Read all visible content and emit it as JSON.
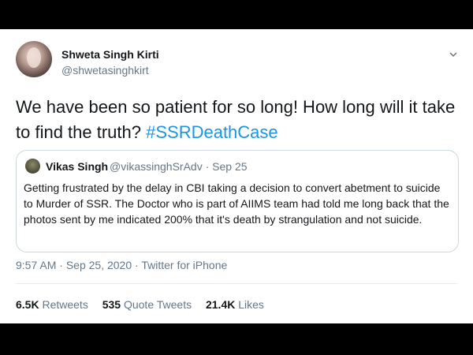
{
  "author": {
    "name": "Shweta Singh Kirti",
    "handle": "@shwetasinghkirt"
  },
  "tweet": {
    "text": "We have been so patient for so long! How long will it take to find the truth? ",
    "hashtag": "#SSRDeathCase"
  },
  "quoted": {
    "name": "Vikas Singh",
    "handle": "@vikassinghSrAdv",
    "separator": " · ",
    "date": "Sep 25",
    "text": "Getting frustrated by the delay in CBI taking a decision to convert abetment to suicide to Murder of SSR. The Doctor who is part of AIIMS team had told me long back that the photos sent by me indicated 200% that it's death by strangulation and not suicide."
  },
  "meta": {
    "time": "9:57 AM",
    "separator": " · ",
    "date": "Sep 25, 2020",
    "source": "Twitter for iPhone"
  },
  "stats": {
    "retweets_count": "6.5K",
    "retweets_label": " Retweets",
    "quotes_count": "535",
    "quotes_label": " Quote Tweets",
    "likes_count": "21.4K",
    "likes_label": " Likes"
  },
  "colors": {
    "hashtag": "#1b95e0",
    "secondary_text": "#657786",
    "primary_text": "#14171a",
    "border": "#ccd6dd"
  },
  "icons": {
    "menu": "chevron-down-icon"
  }
}
